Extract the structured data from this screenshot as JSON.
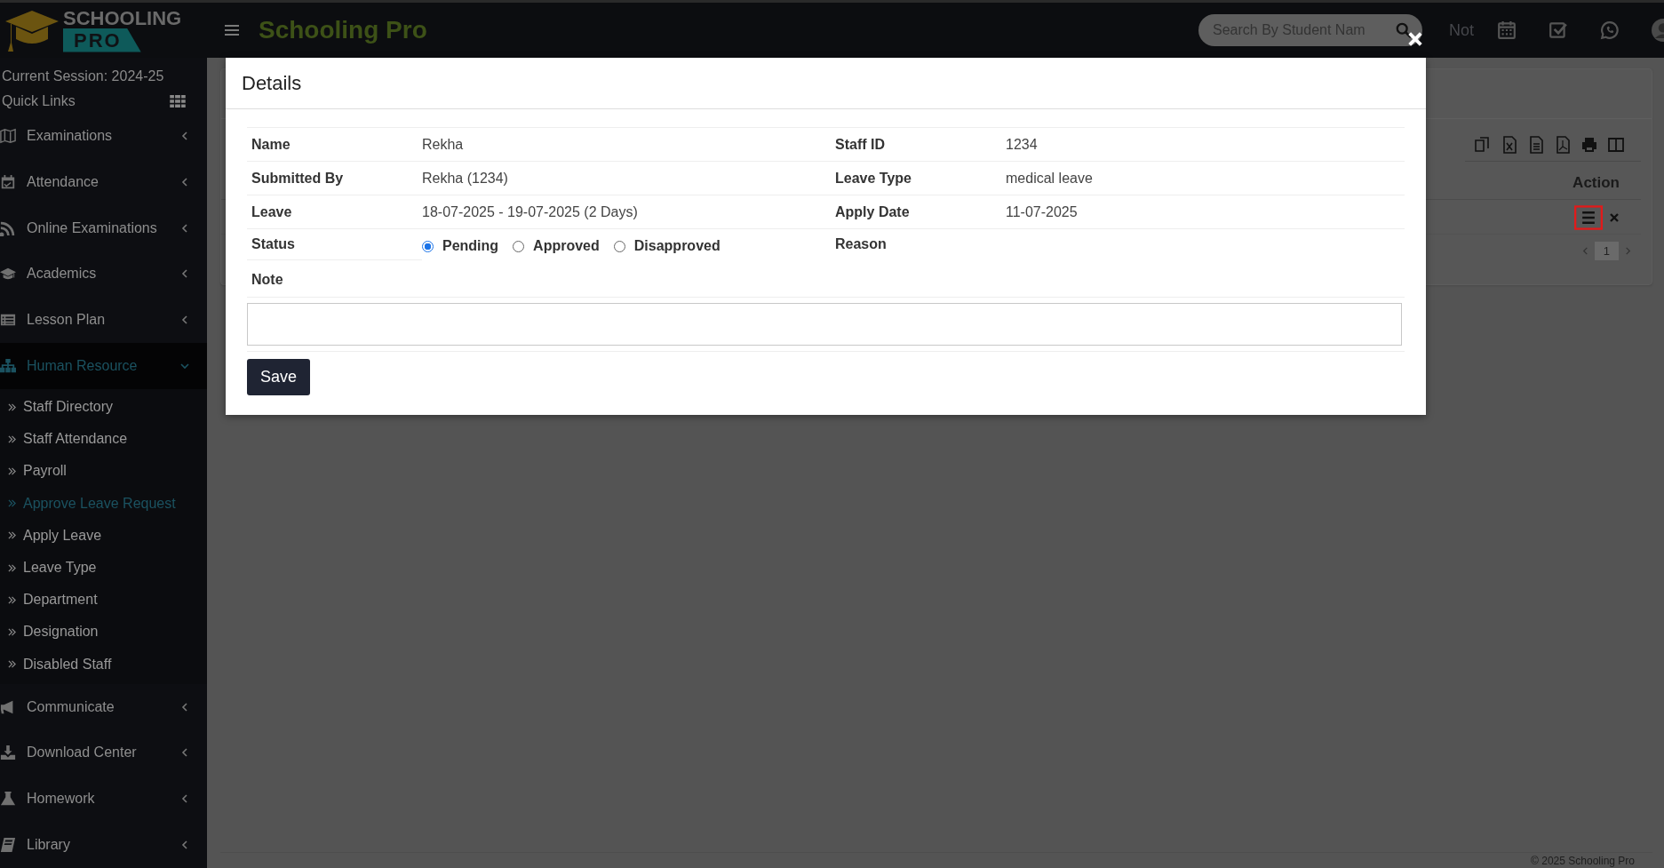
{
  "header": {
    "logo": {
      "line_1": "SCHOOLING",
      "line_2": "PRO"
    },
    "title": "Schooling Pro",
    "search": {
      "placeholder": "Search By Student Nam"
    },
    "notice_text": "Not"
  },
  "sidebar": {
    "session": "Current Session: 2024-25",
    "quick_links": "Quick Links",
    "items": [
      {
        "label": "Examinations",
        "expanded": false
      },
      {
        "label": "Attendance",
        "expanded": false
      },
      {
        "label": "Online Examinations",
        "expanded": false
      },
      {
        "label": "Academics",
        "expanded": false
      },
      {
        "label": "Lesson Plan",
        "expanded": false
      },
      {
        "label": "Human Resource",
        "expanded": true,
        "children": [
          {
            "label": "Staff Directory",
            "selected": false
          },
          {
            "label": "Staff Attendance",
            "selected": false
          },
          {
            "label": "Payroll",
            "selected": false
          },
          {
            "label": "Approve Leave Request",
            "selected": true
          },
          {
            "label": "Apply Leave",
            "selected": false
          },
          {
            "label": "Leave Type",
            "selected": false
          },
          {
            "label": "Department",
            "selected": false
          },
          {
            "label": "Designation",
            "selected": false
          },
          {
            "label": "Disabled Staff",
            "selected": false
          }
        ]
      },
      {
        "label": "Communicate",
        "expanded": false
      },
      {
        "label": "Download Center",
        "expanded": false
      },
      {
        "label": "Homework",
        "expanded": false
      },
      {
        "label": "Library",
        "expanded": false
      }
    ]
  },
  "list_card": {
    "action_header": "Action",
    "pagination": [
      {
        "label": "1",
        "selected": true
      }
    ]
  },
  "footer": "© 2025 Schooling Pro",
  "modal": {
    "title": "Details",
    "rows": [
      [
        {
          "label": "Name",
          "value": "Rekha"
        },
        {
          "label": "Staff ID",
          "value": "1234"
        }
      ],
      [
        {
          "label": "Submitted By",
          "value": "Rekha (1234)"
        },
        {
          "label": "Leave Type",
          "value": "medical leave"
        }
      ],
      [
        {
          "label": "Leave",
          "value": "18-07-2025 - 19-07-2025 (2 Days)"
        },
        {
          "label": "Apply Date",
          "value": "11-07-2025"
        }
      ]
    ],
    "status": {
      "label": "Status",
      "options": [
        {
          "label": "Pending",
          "selected": true
        },
        {
          "label": "Approved",
          "selected": false
        },
        {
          "label": "Disapproved",
          "selected": false
        }
      ]
    },
    "reason": {
      "label": "Reason"
    },
    "note": {
      "label": "Note"
    },
    "save_button": "Save"
  }
}
